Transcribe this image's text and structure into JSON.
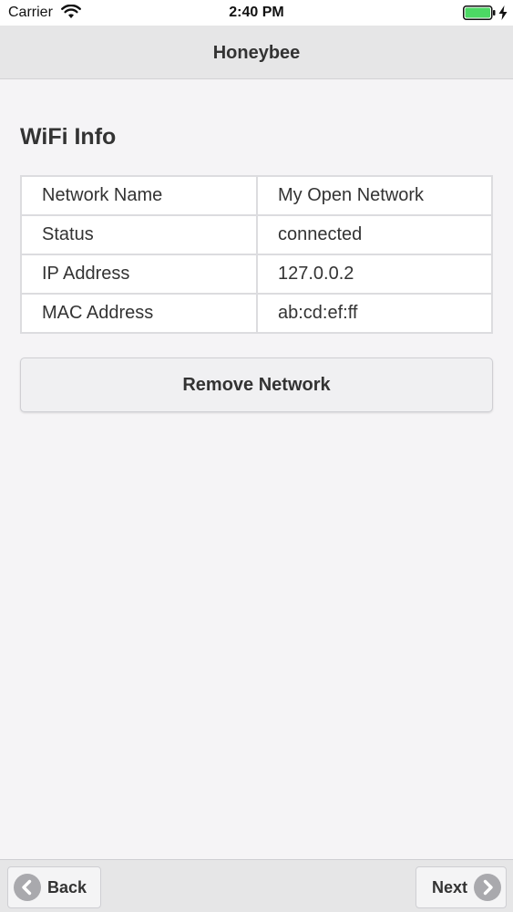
{
  "status_bar": {
    "carrier": "Carrier",
    "time": "2:40 PM",
    "battery_color": "#4cd964"
  },
  "header": {
    "title": "Honeybee"
  },
  "wifi_info": {
    "title": "WiFi Info",
    "rows": [
      {
        "label": "Network Name",
        "value": "My Open Network"
      },
      {
        "label": "Status",
        "value": "connected"
      },
      {
        "label": "IP Address",
        "value": "127.0.0.2"
      },
      {
        "label": "MAC Address",
        "value": "ab:cd:ef:ff"
      }
    ],
    "remove_label": "Remove Network"
  },
  "footer": {
    "back_label": "Back",
    "next_label": "Next",
    "back_icon": "chevron-left-circle-icon",
    "next_icon": "chevron-right-circle-icon"
  }
}
